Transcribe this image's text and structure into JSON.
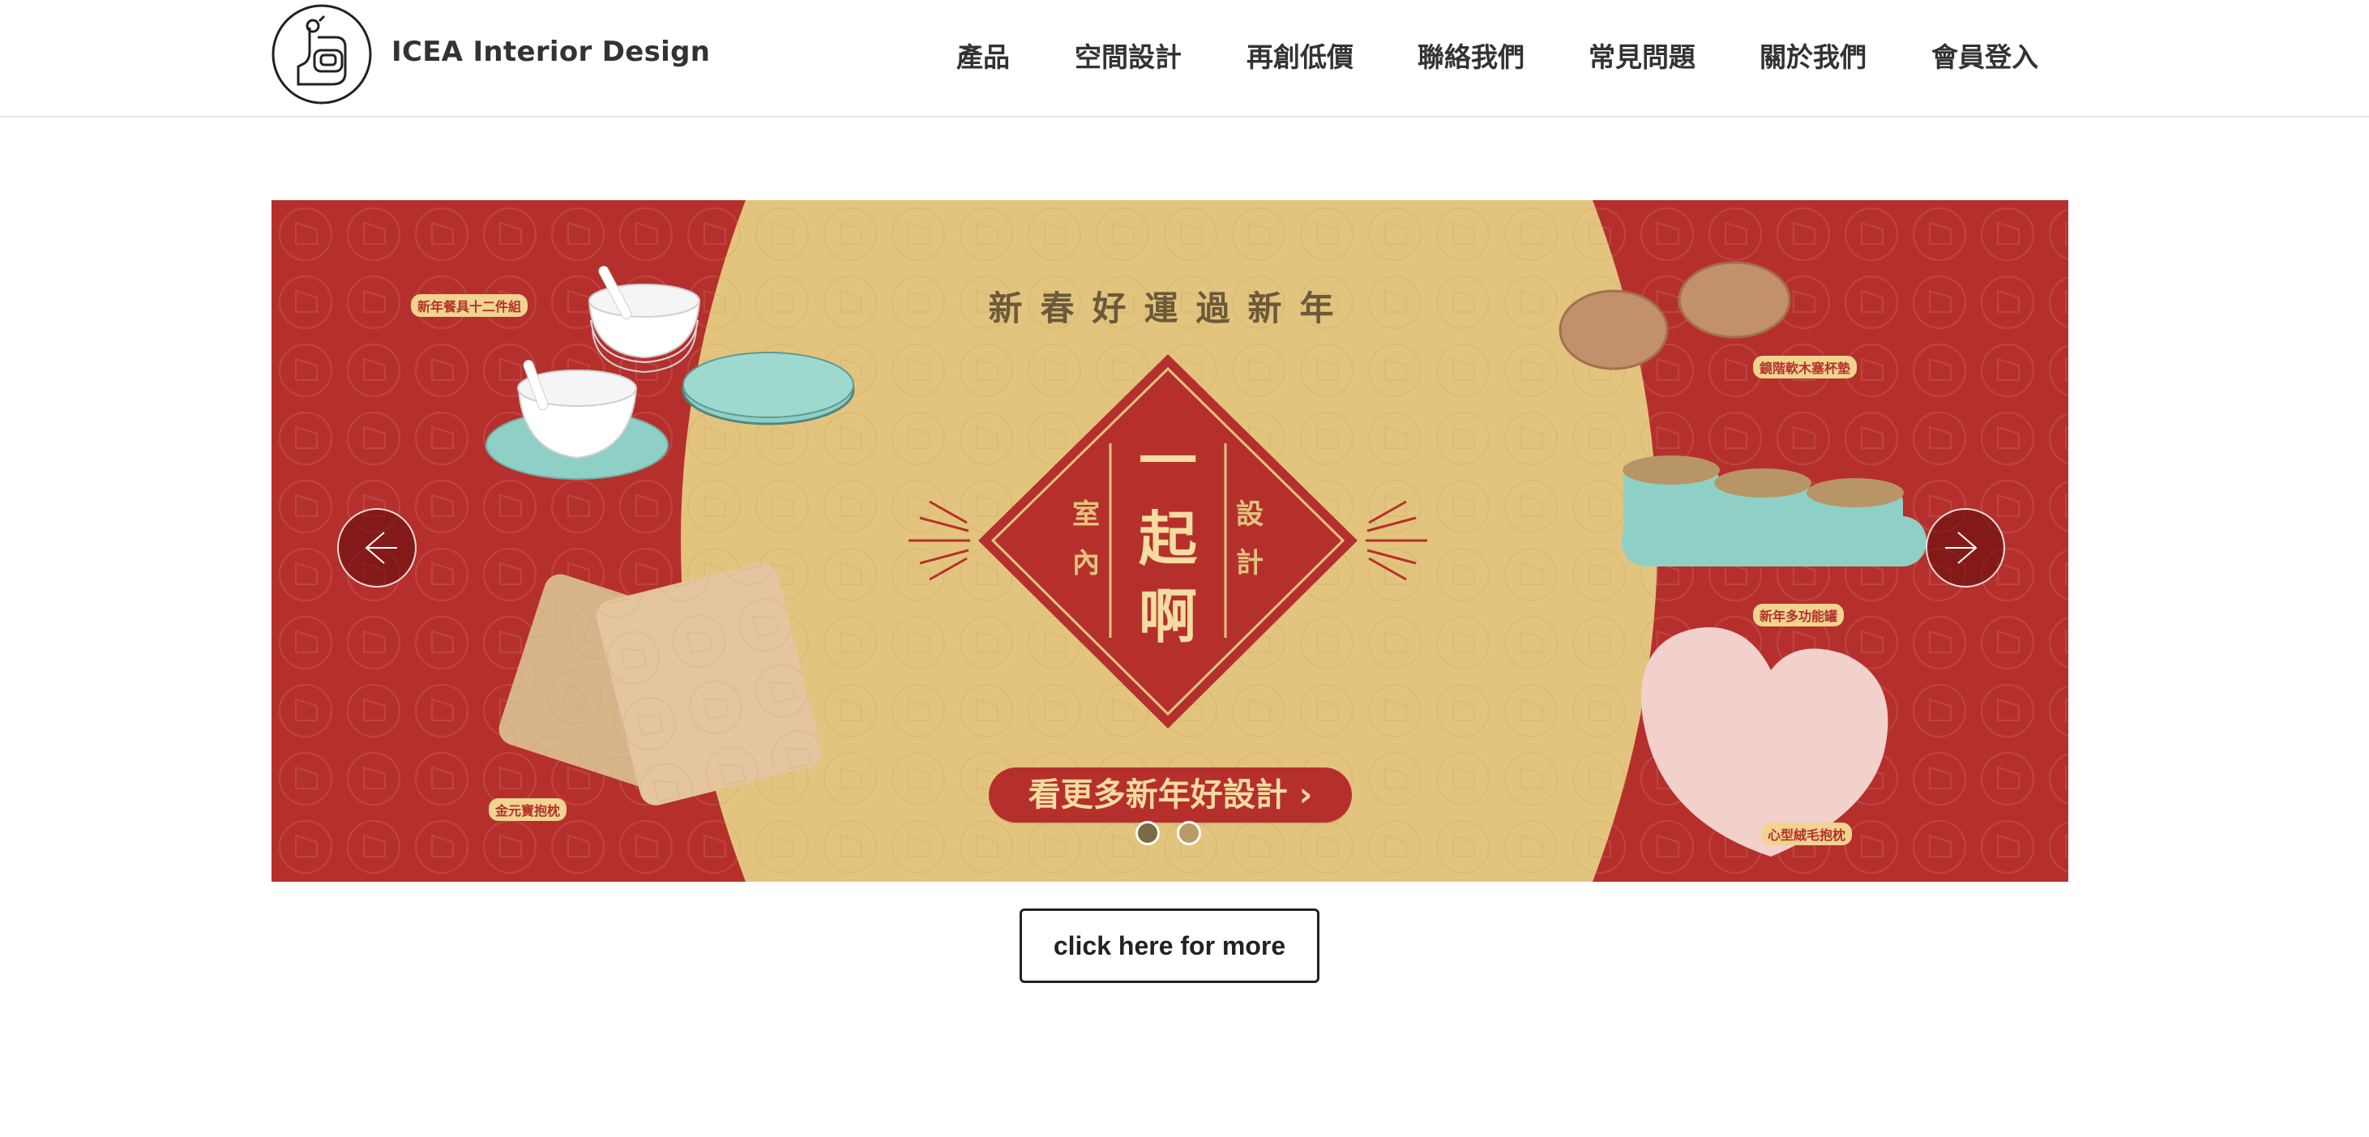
{
  "header": {
    "brand": "ICEA Interior Design",
    "nav": [
      {
        "label": "產品",
        "name": "nav-products"
      },
      {
        "label": "空間設計",
        "name": "nav-space-design"
      },
      {
        "label": "再創低價",
        "name": "nav-low-price"
      },
      {
        "label": "聯絡我們",
        "name": "nav-contact"
      },
      {
        "label": "常見問題",
        "name": "nav-faq"
      },
      {
        "label": "關於我們",
        "name": "nav-about"
      },
      {
        "label": "會員登入",
        "name": "nav-login"
      }
    ]
  },
  "banner": {
    "headline": "新春好運過新年",
    "diamond": {
      "left_text": "室內",
      "big_text": "一起啊",
      "right_text": "設計"
    },
    "cta": "看更多新年好設計 ›",
    "tags": {
      "tableware": "新年餐具十二件組",
      "coaster": "鏡階軟木塞杯墊",
      "container": "新年多功能罐",
      "pillow_gold": "金元寶抱枕",
      "pillow_heart": "心型絨毛抱枕"
    },
    "slides_total": 2,
    "active_slide": 1
  },
  "more_button": "click here for more",
  "colors": {
    "banner_red": "#b5302d",
    "banner_gold": "#e3c47e",
    "dot_active": "#7a6a45",
    "dot_inactive": "#b89c63"
  }
}
